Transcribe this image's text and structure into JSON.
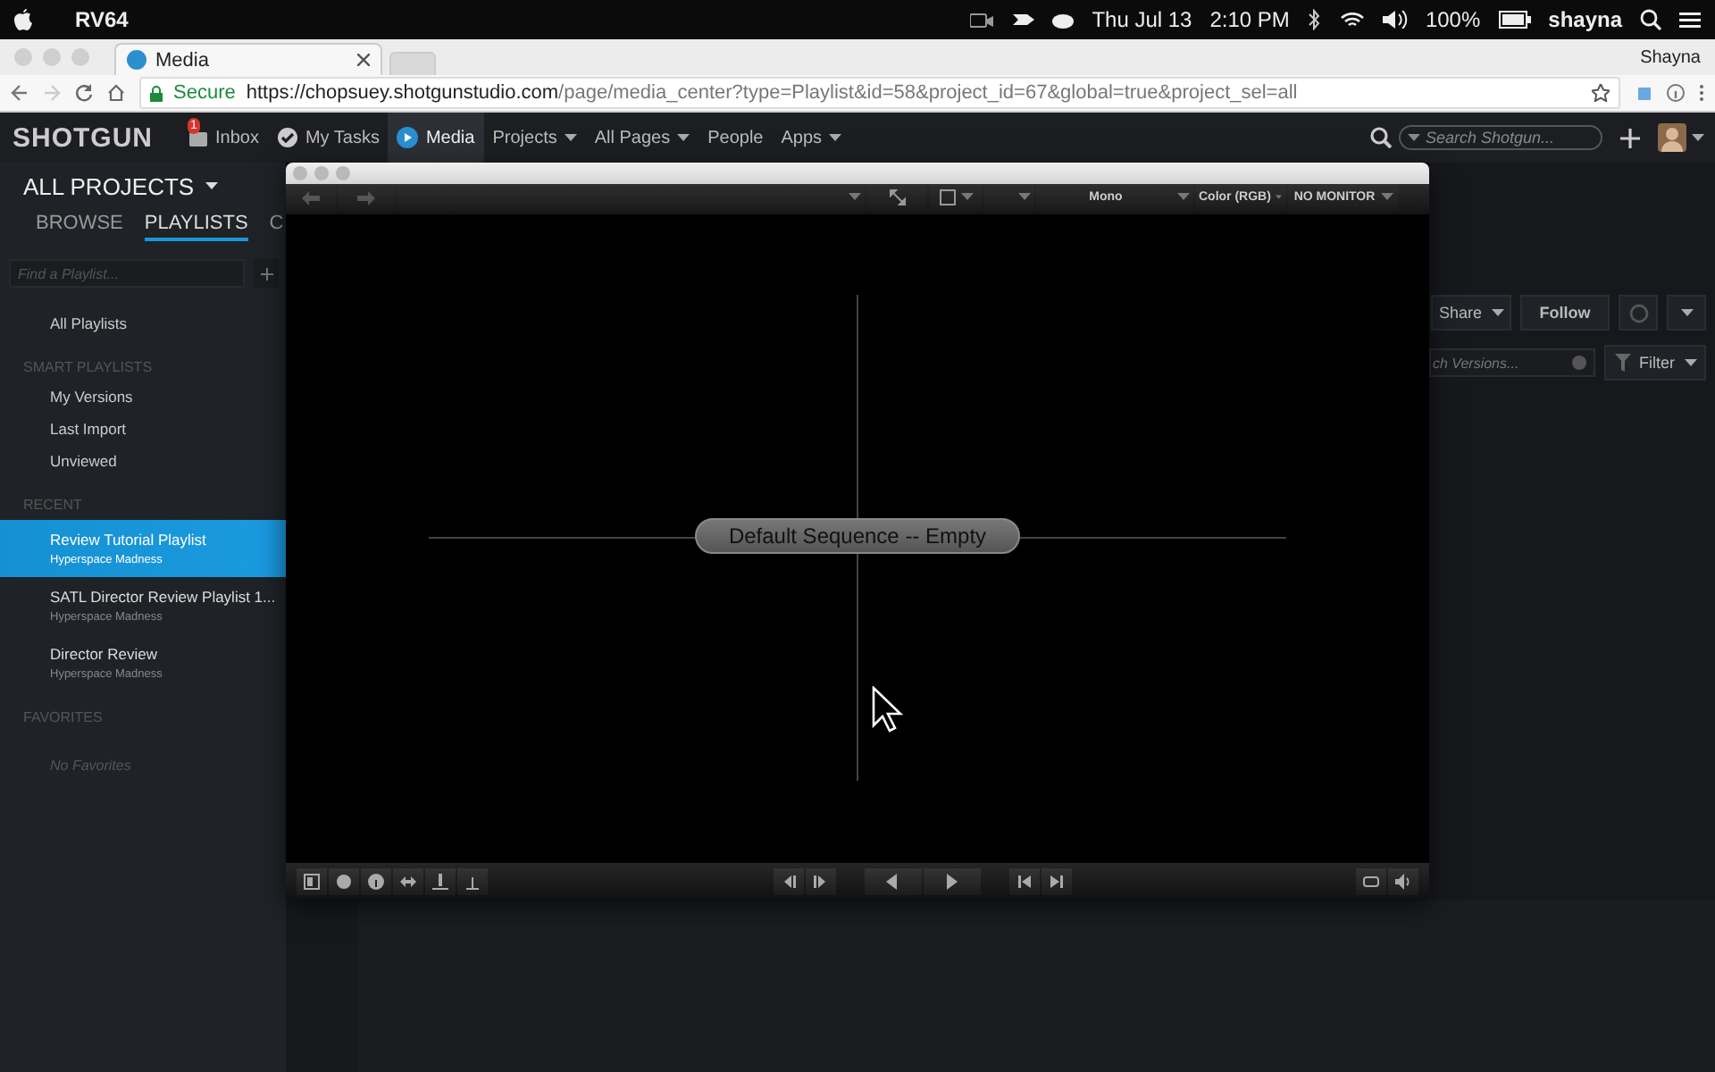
{
  "menubar": {
    "app": "RV64",
    "date": "Thu Jul 13",
    "time": "2:10 PM",
    "battery": "100%",
    "user": "shayna"
  },
  "browser": {
    "tab": {
      "title": "Media"
    },
    "profile": "Shayna",
    "secure_label": "Secure",
    "url_host": "https://chopsuey.shotgunstudio.com",
    "url_path": "/page/media_center?type=Playlist&id=58&project_id=67&global=true&project_sel=all"
  },
  "nav": {
    "logo": "SHOTGUN",
    "items": [
      {
        "label": "Inbox",
        "kind": "inbox",
        "badge": "1",
        "selected": false
      },
      {
        "label": "My Tasks",
        "kind": "tasks",
        "selected": false
      },
      {
        "label": "Media",
        "kind": "media",
        "selected": true
      },
      {
        "label": "Projects",
        "kind": "menu",
        "selected": false
      },
      {
        "label": "All Pages",
        "kind": "menu",
        "selected": false
      },
      {
        "label": "People",
        "kind": "link",
        "selected": false
      },
      {
        "label": "Apps",
        "kind": "menu",
        "selected": false
      }
    ],
    "search": {
      "placeholder": "Search Shotgun..."
    }
  },
  "sidebar": {
    "project": "ALL PROJECTS",
    "tabs": [
      {
        "label": "BROWSE",
        "selected": false
      },
      {
        "label": "PLAYLISTS",
        "selected": true
      },
      {
        "label": "C",
        "selected": false
      }
    ],
    "search": {
      "placeholder": "Find a Playlist..."
    },
    "items": [
      {
        "kind": "item",
        "label": "All Playlists",
        "selected": false
      },
      {
        "kind": "header",
        "label": "SMART PLAYLISTS"
      },
      {
        "kind": "item",
        "label": "My Versions",
        "selected": false
      },
      {
        "kind": "item",
        "label": "Last Import",
        "selected": false
      },
      {
        "kind": "item",
        "label": "Unviewed",
        "selected": false
      },
      {
        "kind": "header",
        "label": "RECENT"
      },
      {
        "kind": "playlist",
        "label": "Review Tutorial Playlist",
        "subtitle": "Hyperspace Madness",
        "selected": true
      },
      {
        "kind": "playlist",
        "label": "SATL Director Review Playlist 1...",
        "subtitle": "Hyperspace Madness",
        "selected": false
      },
      {
        "kind": "playlist",
        "label": "Director Review",
        "subtitle": "Hyperspace Madness",
        "selected": false
      },
      {
        "kind": "header",
        "label": "FAVORITES"
      },
      {
        "kind": "empty",
        "label": "No Favorites"
      }
    ]
  },
  "toolbar": {
    "share": "Share",
    "follow": "Follow",
    "search": {
      "placeholder": "ch Versions..."
    },
    "filter": "Filter"
  },
  "viewer": {
    "dropdowns": [
      "Mono",
      "Color (RGB)",
      "NO MONITOR"
    ],
    "sequence": "Default Sequence -- Empty"
  }
}
